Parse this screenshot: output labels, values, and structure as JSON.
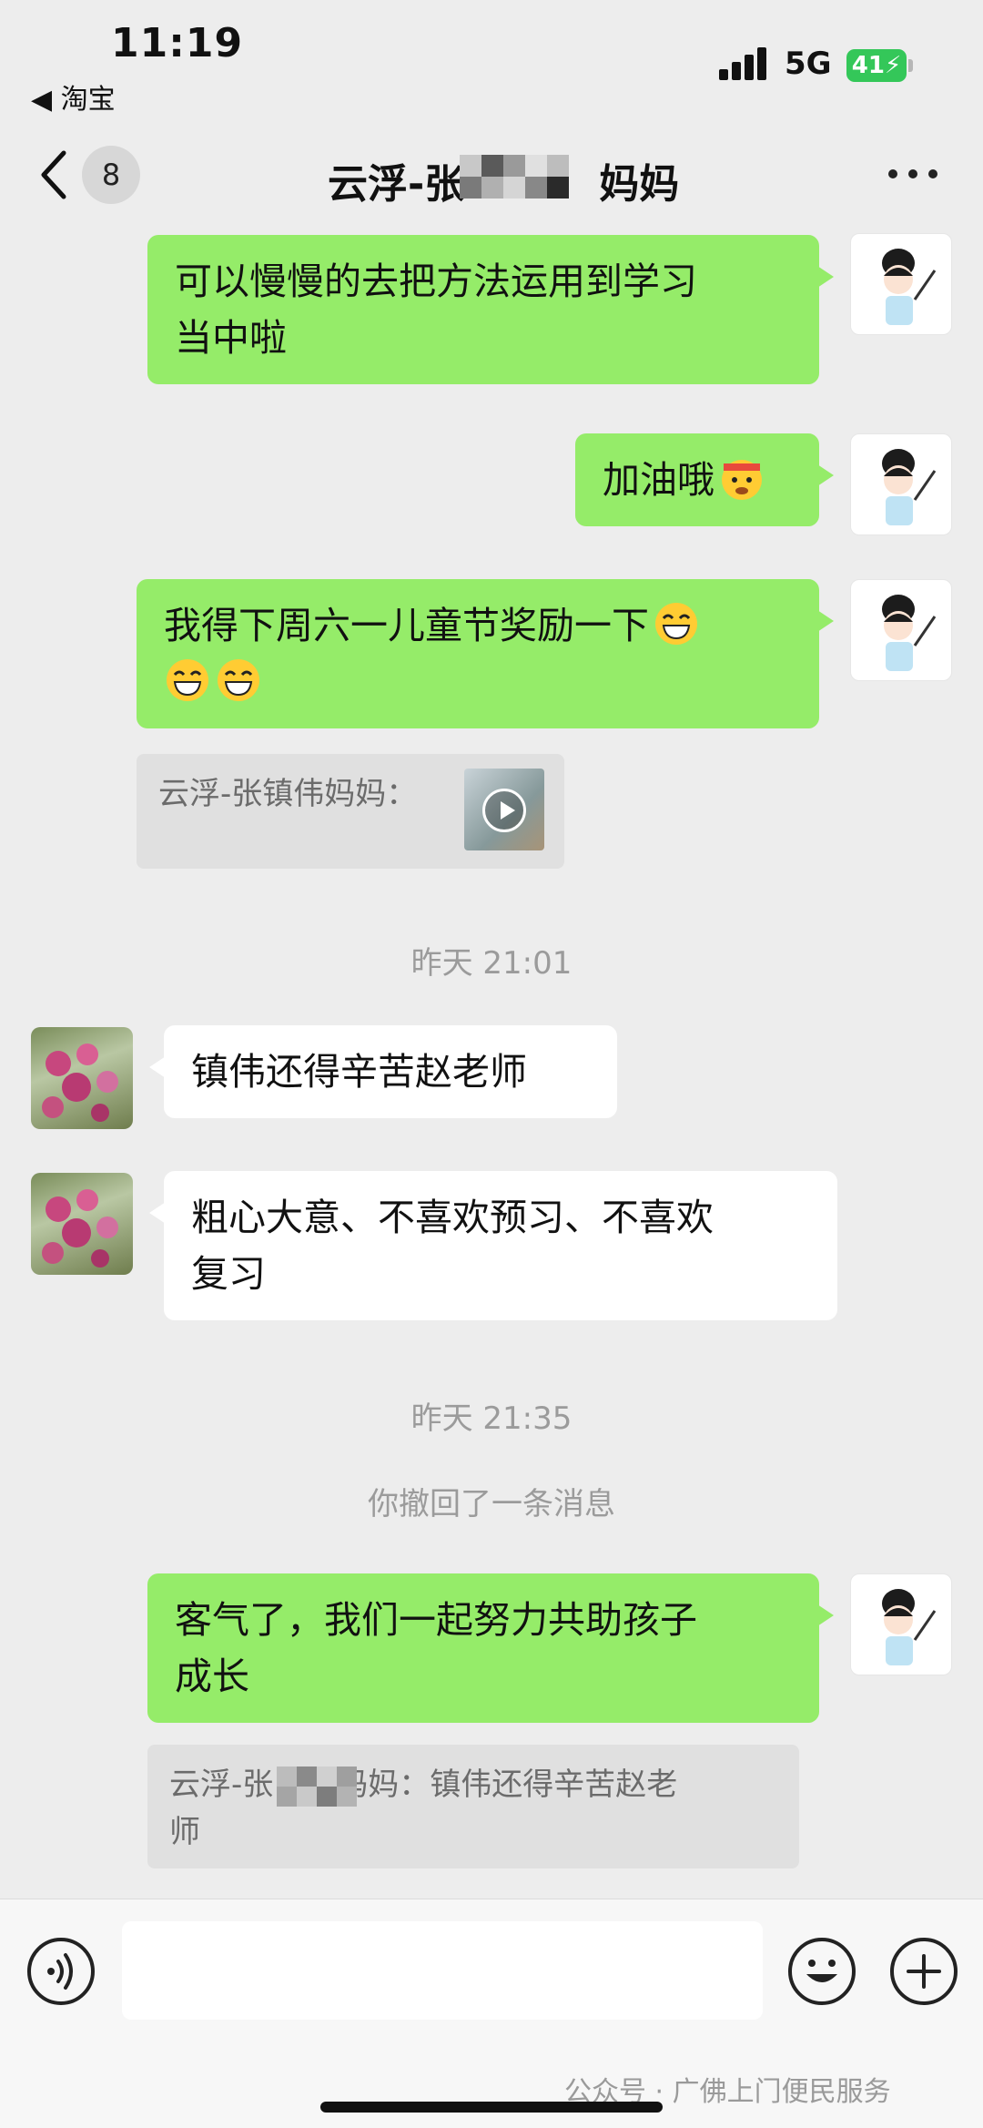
{
  "status_bar": {
    "time": "11:19",
    "back_app": "◀ 淘宝",
    "network": "5G",
    "battery": "41"
  },
  "nav": {
    "unread_count": "8",
    "title": "云浮-张██妈妈",
    "title_prefix": "云浮-张",
    "title_suffix": "妈妈"
  },
  "messages": [
    {
      "from": "me",
      "lines": [
        "可以慢慢的去把方法运用到学习",
        "当中啦"
      ]
    },
    {
      "from": "me",
      "text": "加油哦",
      "emoji": "salute-emoji"
    },
    {
      "from": "me",
      "lines": [
        "我得下周六一儿童节奖励一下",
        ""
      ],
      "emoji": "grin-emoji"
    },
    {
      "from": "me",
      "quote": "云浮-张镇伟妈妈："
    },
    {
      "type": "timestamp",
      "text": "昨天 21:01"
    },
    {
      "from": "other",
      "text": "镇伟还得辛苦赵老师"
    },
    {
      "from": "other",
      "lines": [
        "粗心大意、不喜欢预习、不喜欢",
        "复习"
      ]
    },
    {
      "type": "timestamp",
      "text": "昨天 21:35"
    },
    {
      "type": "system",
      "text": "你撤回了一条消息"
    },
    {
      "from": "me",
      "lines": [
        "客气了，我们一起努力共助孩子",
        "成长"
      ]
    },
    {
      "from": "me",
      "quote_lines": [
        "云浮-张",
        "妈妈：镇伟还得辛苦赵老",
        "师"
      ]
    }
  ],
  "input": {
    "placeholder": ""
  },
  "watermark": "公众号 · 广佛上门便民服务",
  "colors": {
    "me_bubble": "#95ec69",
    "other_bubble": "#ffffff",
    "background": "#ededed"
  }
}
